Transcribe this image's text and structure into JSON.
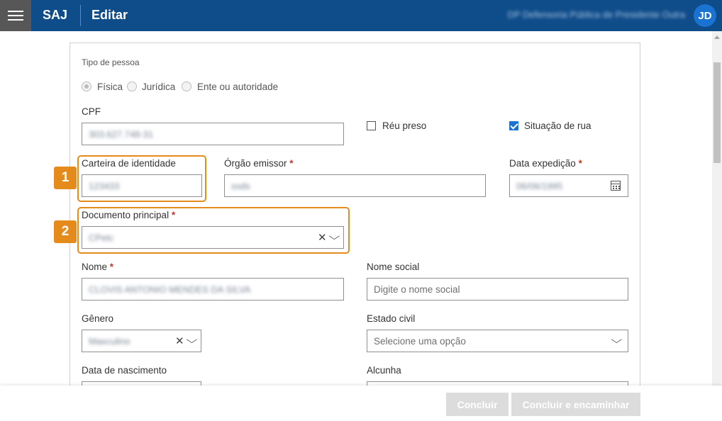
{
  "header": {
    "app_name": "SAJ",
    "page_title": "Editar",
    "unit_name": "DP Defensoria Pública de Presidente Outra",
    "user_initials": "JD"
  },
  "form": {
    "person_type": {
      "label": "Tipo de pessoa",
      "options": [
        "Física",
        "Jurídica",
        "Ente ou autoridade"
      ],
      "selected": "Física"
    },
    "cpf": {
      "label": "CPF",
      "value": "303.627.748-31"
    },
    "reu_preso": {
      "label": "Réu preso",
      "checked": false
    },
    "situacao_rua": {
      "label": "Situação de rua",
      "checked": true
    },
    "carteira_identidade": {
      "label": "Carteira de identidade",
      "value": "123433"
    },
    "orgao_emissor": {
      "label": "Órgão emissor",
      "required_mark": "*",
      "value": "ssds"
    },
    "data_expedicao": {
      "label": "Data expedição",
      "required_mark": "*",
      "value": "06/06/1995"
    },
    "documento_principal": {
      "label": "Documento principal",
      "required_mark": "*",
      "value": "CPetc"
    },
    "nome": {
      "label": "Nome",
      "required_mark": "*",
      "value": "CLOVIS ANTONIO MENDES DA SILVA"
    },
    "nome_social": {
      "label": "Nome social",
      "placeholder": "Digite o nome social"
    },
    "genero": {
      "label": "Gênero",
      "value": "Masculino"
    },
    "estado_civil": {
      "label": "Estado civil",
      "placeholder": "Selecione uma opção"
    },
    "data_nascimento": {
      "label": "Data de nascimento"
    },
    "alcunha": {
      "label": "Alcunha"
    }
  },
  "highlights": [
    {
      "number": "1",
      "color": "#e58b1c"
    },
    {
      "number": "2",
      "color": "#e58b1c"
    }
  ],
  "footer": {
    "concluir_label": "Concluir",
    "concluir_encaminhar_label": "Concluir e encaminhar"
  },
  "colors": {
    "header_bg": "#0f4c8a",
    "accent": "#1a73d1",
    "highlight": "#e58b1c",
    "required": "#c0392b",
    "disabled_button": "#dcdcdc"
  }
}
